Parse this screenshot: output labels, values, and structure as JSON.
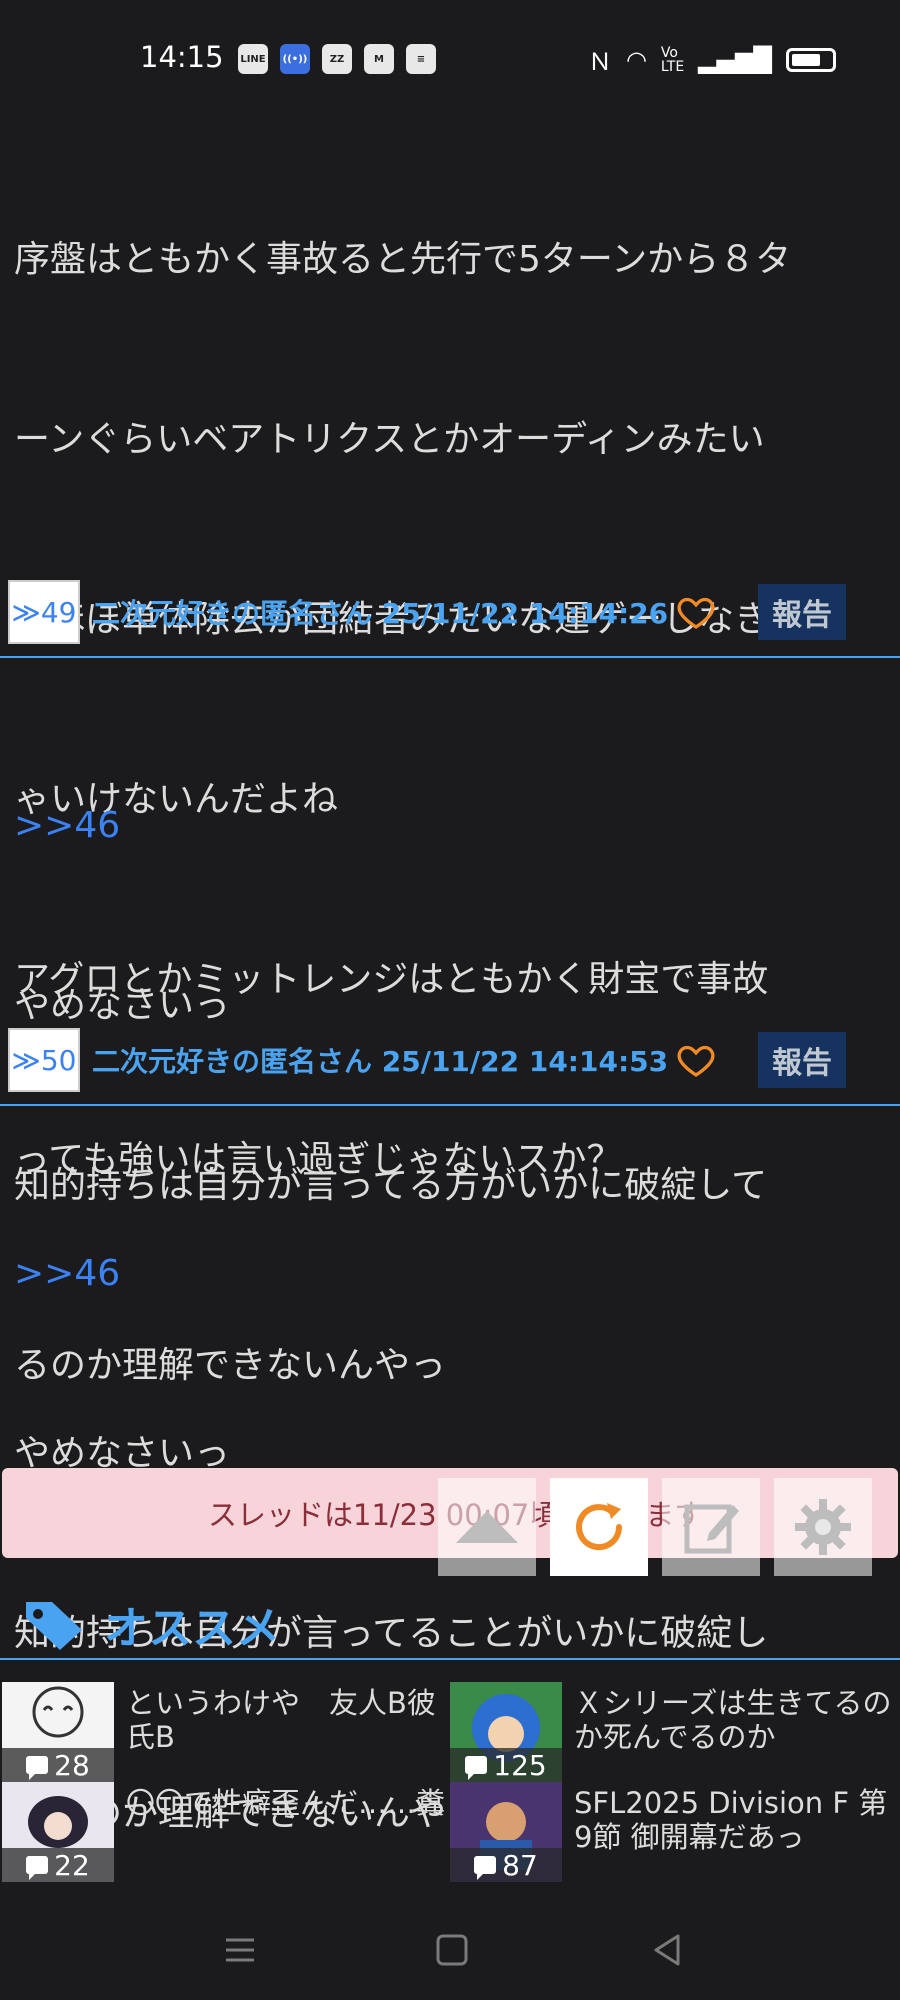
{
  "status_bar": {
    "time": "14:15",
    "left_icons": [
      "line-icon",
      "broadcast-icon",
      "app-icon",
      "gmail-icon",
      "stack-icon"
    ],
    "right_icons": [
      "nfc-icon",
      "wifi-icon",
      "volte-icon",
      "signal-icon",
      "battery-icon"
    ]
  },
  "posts": [
    {
      "reply": "",
      "lines": [
        "序盤はともかく事故ると先行で5ターンから８タ",
        "ーンぐらいベアトリクスとかオーディンみたい",
        "なほぼ単体除去か団結者みたいな運ゲーしなき",
        "ゃいけないんだよね",
        "アグロとかミットレンジはともかく財宝で事故",
        "っても強いは言い過ぎじゃないスか？"
      ]
    },
    {
      "number": "≫49",
      "author": "二次元好きの匿名さん 25/11/22 14:14:26",
      "report": "報告",
      "reply": ">>46",
      "lines": [
        "やめなさいっ",
        "知的持ちは自分が言ってる方がいかに破綻して",
        "るのか理解できないんやっ"
      ]
    },
    {
      "number": "≫50",
      "author": "二次元好きの匿名さん 25/11/22 14:14:53",
      "report": "報告",
      "reply": ">>46",
      "lines": [
        "やめなさいっ",
        "知的持ちは自分が言ってることがいかに破綻し",
        "てるのか理解できないんやっ"
      ]
    }
  ],
  "banner": {
    "text": "スレッドは11/23 00:07頃に落ちます"
  },
  "recommend": {
    "title": "オススメ",
    "items": [
      {
        "text": "というわけや　友人B彼氏B",
        "count": "28"
      },
      {
        "text": "Ｘシリーズは生きてるのか死んでるのか",
        "count": "125"
      },
      {
        "text": "〇〇で性癖歪んだ……糞",
        "count": "22"
      },
      {
        "text": "SFL2025 Division F 第9節 御開幕だあっ",
        "count": "87"
      }
    ]
  },
  "colors": {
    "background": "#1b1b1d",
    "accent": "#4aa3f0",
    "reply_link": "#3b82f6",
    "heart": "#f08a24",
    "report_bg": "#15335e",
    "banner_bg": "#f7d4d9"
  }
}
